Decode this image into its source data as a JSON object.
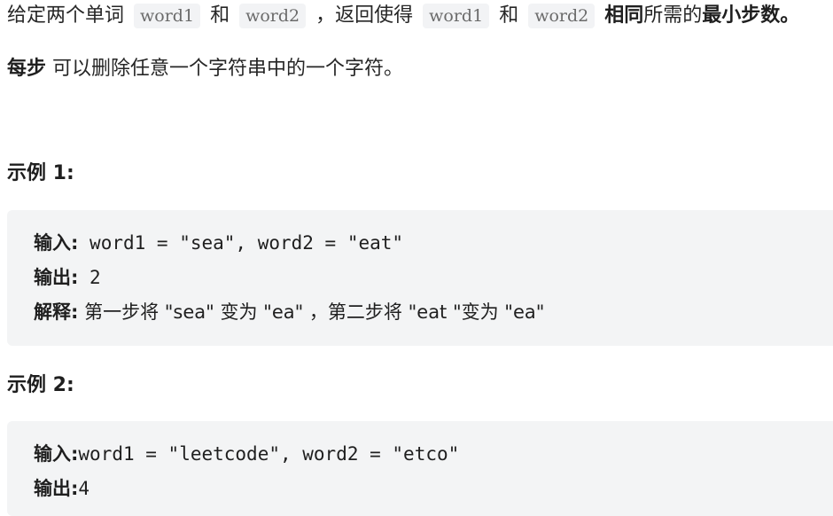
{
  "intro": {
    "p1": "给定两个单词",
    "code_a": "word1",
    "p2": "和",
    "code_b": "word2",
    "p3": "，返回使得",
    "code_c": "word1",
    "p4": "和",
    "code_d": "word2",
    "bold1": "相同",
    "p5": "所需的",
    "bold2": "最小步数",
    "p6": "。"
  },
  "step_line": {
    "bold": "每步",
    "text": " 可以删除任意一个字符串中的一个字符。"
  },
  "example1": {
    "heading": "示例 1:",
    "input_label": "输入:",
    "input_value": " word1 = \"sea\", word2 = \"eat\"",
    "output_label": "输出:",
    "output_value": " 2",
    "explain_label": "解释:",
    "explain_text": " 第一步将 \"sea\" 变为 \"ea\" ，第二步将 \"eat \"变为 \"ea\""
  },
  "example2": {
    "heading": "示例  2:",
    "input_label": "输入:",
    "input_value": "word1 = \"leetcode\", word2 = \"etco\"",
    "output_label": "输出:",
    "output_value": "4"
  }
}
